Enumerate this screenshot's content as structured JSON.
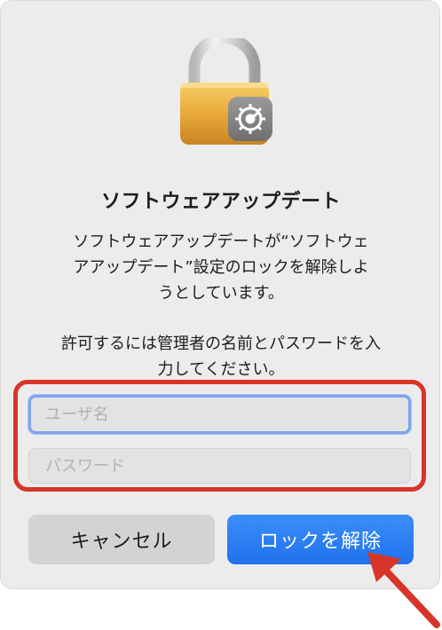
{
  "dialog": {
    "icon": "lock-with-gear-icon",
    "title": "ソフトウェアアップデート",
    "message_lines": [
      "ソフトウェアアップデートが“ソフトウェ",
      "アアップデート”設定のロックを解除しよ",
      "うとしています。"
    ],
    "message": "ソフトウェアアップデートが“ソフトウェ\nアアップデート”設定のロックを解除しよ\nうとしています。",
    "prompt": "許可するには管理者の名前とパスワードを入\n力してください。"
  },
  "form": {
    "username": {
      "placeholder": "ユーザ名",
      "value": ""
    },
    "password": {
      "placeholder": "パスワード",
      "value": ""
    }
  },
  "buttons": {
    "cancel_label": "キャンセル",
    "unlock_label": "ロックを解除"
  },
  "annotations": {
    "highlight_color": "#d8352a",
    "arrow_color": "#d8352a"
  },
  "colors": {
    "accent": "#1f72ec",
    "focus_ring": "#7fa4ee"
  }
}
